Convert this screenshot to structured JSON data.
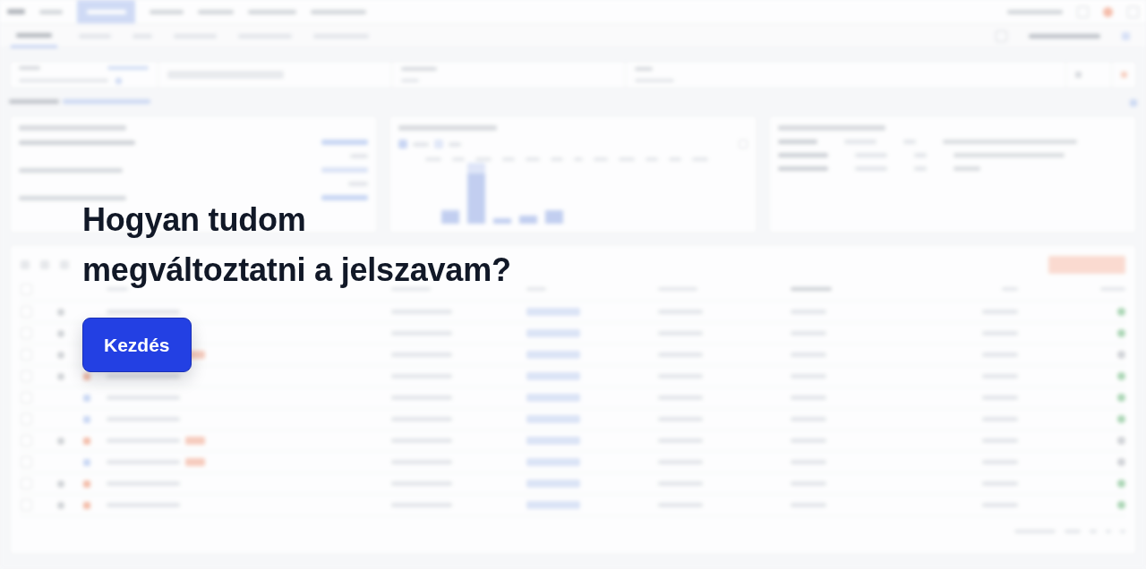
{
  "prompt": {
    "title": "Hogyan tudom megváltoztatni a jelszavam?",
    "button": "Kezdés"
  }
}
